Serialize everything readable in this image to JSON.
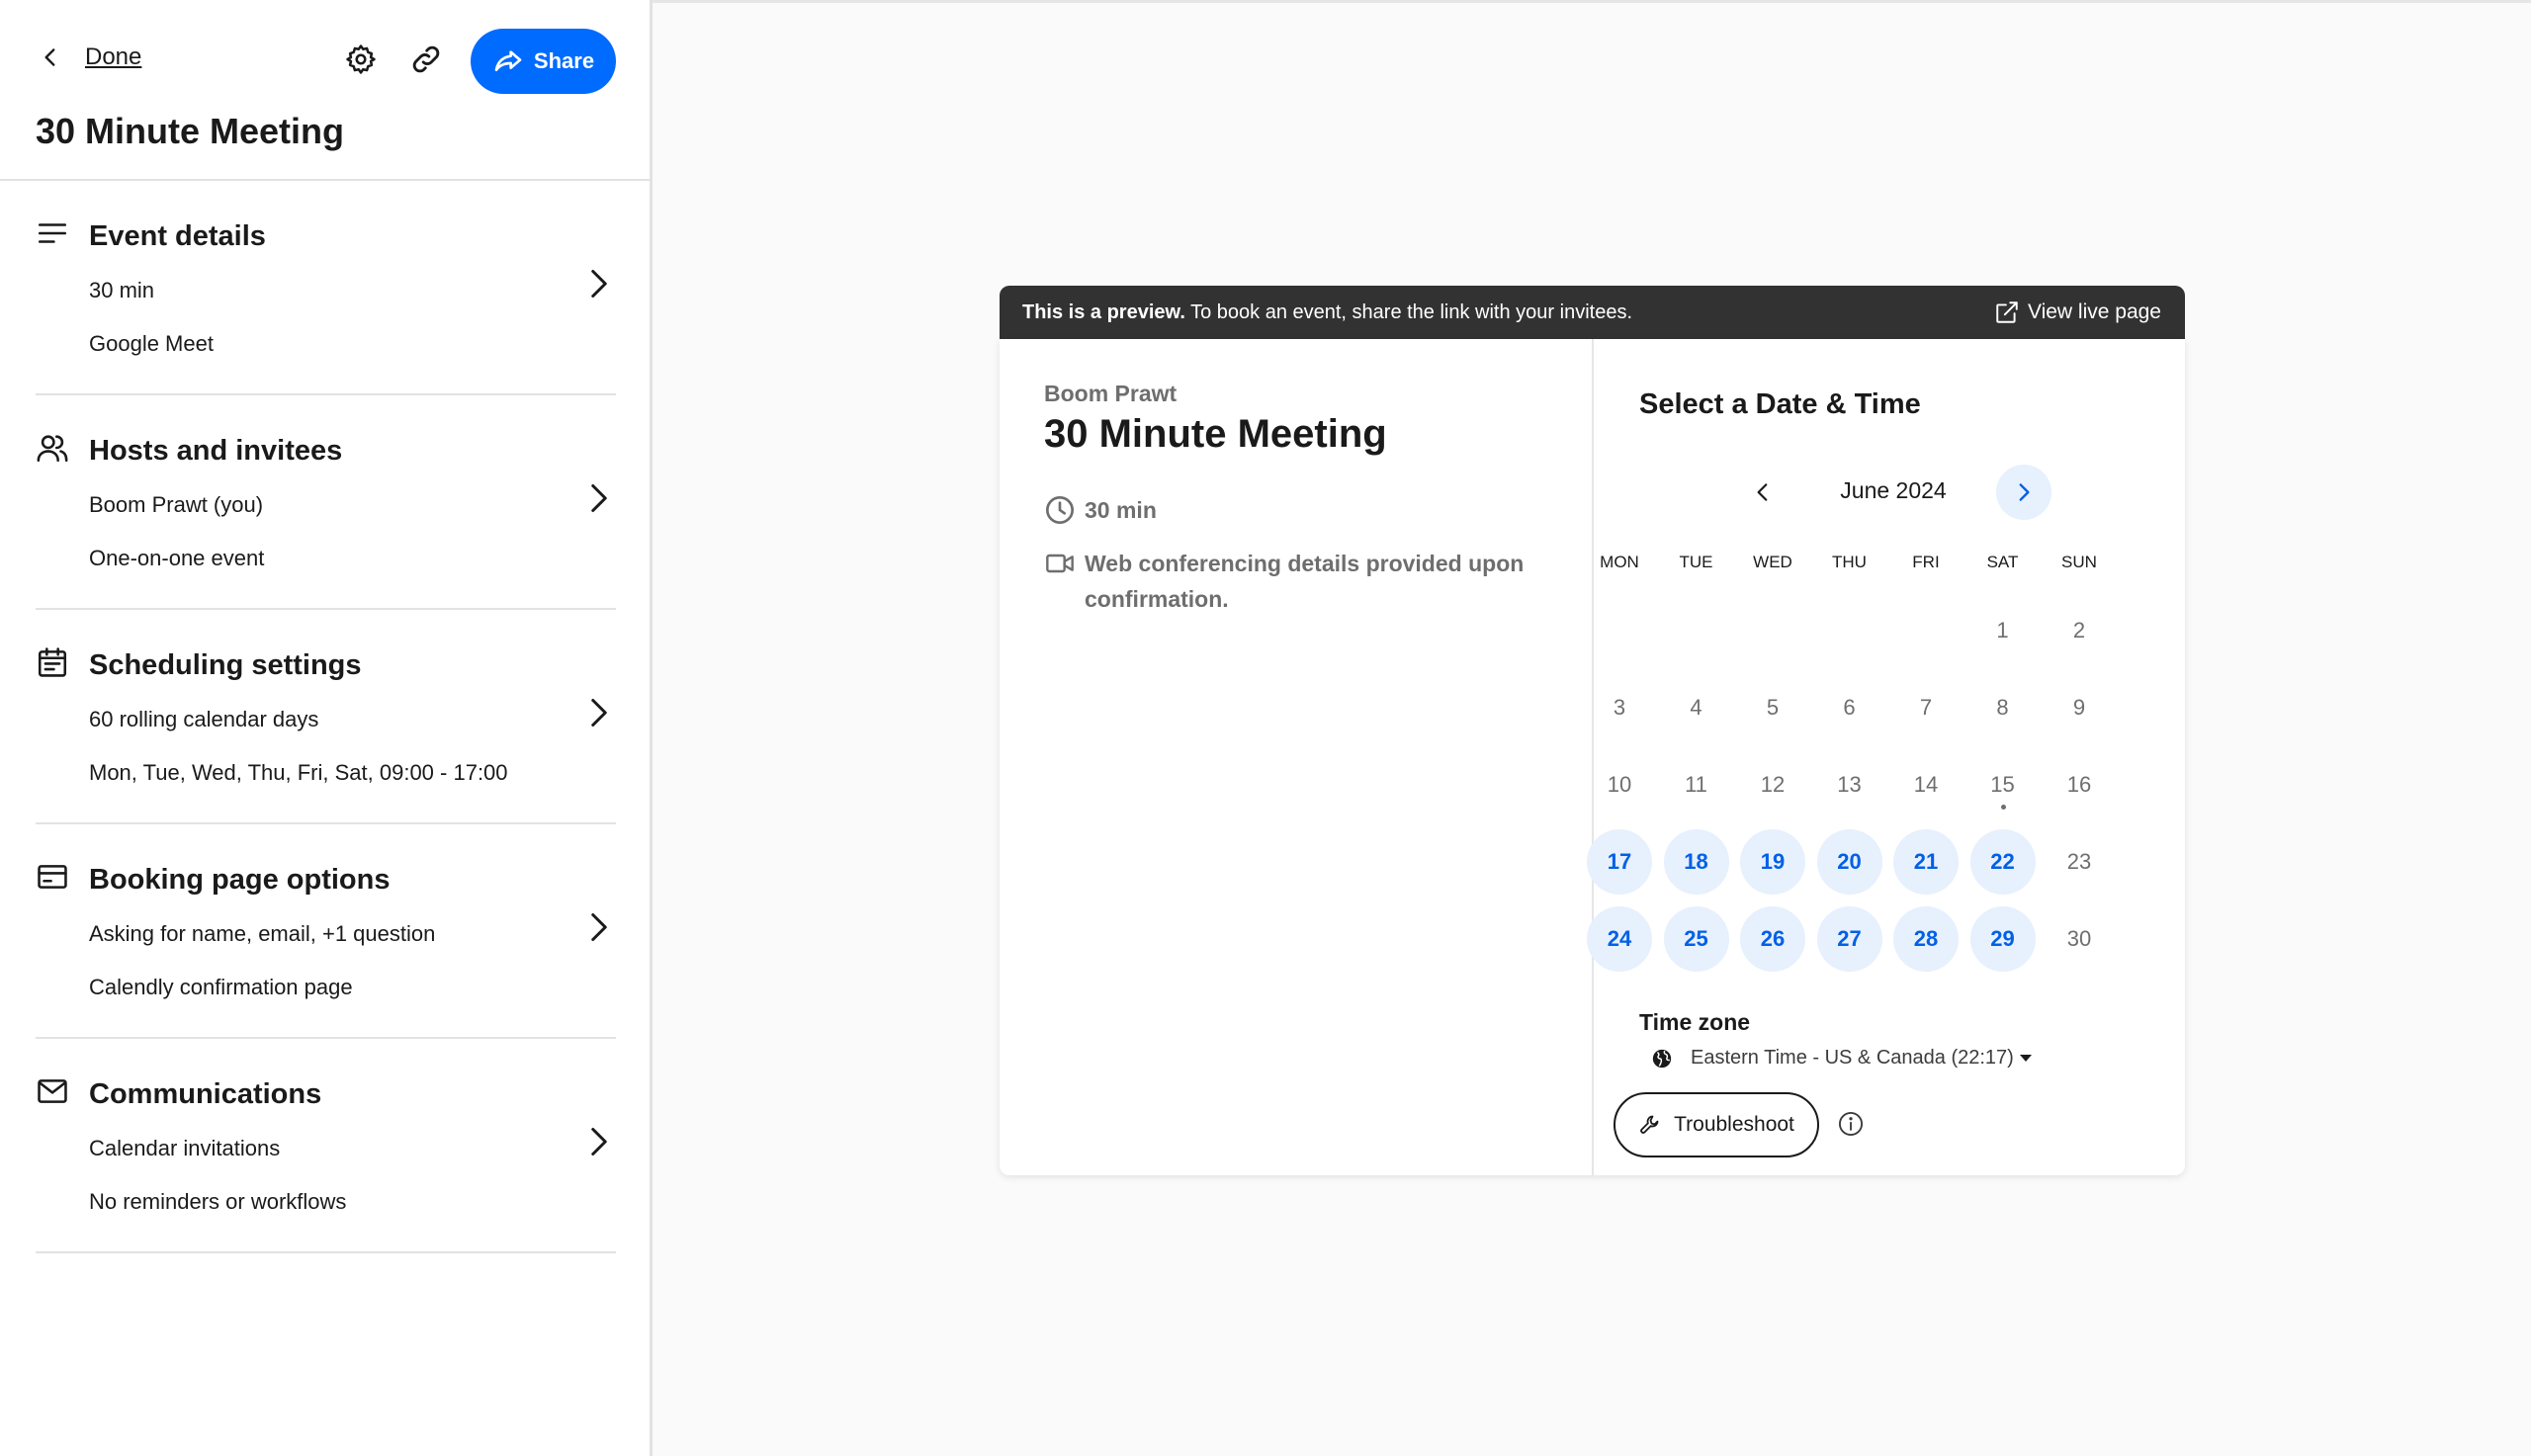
{
  "sidebar": {
    "back_label": "Done",
    "share_label": "Share",
    "title": "30 Minute Meeting",
    "sections": [
      {
        "title": "Event details",
        "line1": "30 min",
        "line2": "Google Meet",
        "icon": "lines-icon"
      },
      {
        "title": "Hosts and invitees",
        "line1": "Boom Prawt (you)",
        "line2": "One-on-one event",
        "icon": "people-icon"
      },
      {
        "title": "Scheduling settings",
        "line1": "60 rolling calendar days",
        "line2": "Mon, Tue, Wed, Thu, Fri, Sat, 09:00 - 17:00",
        "icon": "calendar-icon"
      },
      {
        "title": "Booking page options",
        "line1": "Asking for name, email, +1 question",
        "line2": "Calendly confirmation page",
        "icon": "card-icon"
      },
      {
        "title": "Communications",
        "line1": "Calendar invitations",
        "line2": "No reminders or workflows",
        "icon": "envelope-icon"
      }
    ]
  },
  "preview": {
    "banner_bold": "This is a preview.",
    "banner_text": " To book an event, share the link with your invitees.",
    "view_live_label": "View live page",
    "organizer": "Boom Prawt",
    "event_name": "30 Minute Meeting",
    "duration": "30 min",
    "location": "Web conferencing details provided upon confirmation.",
    "select_title": "Select a Date & Time",
    "month_label": "June 2024",
    "weekdays": [
      "MON",
      "TUE",
      "WED",
      "THU",
      "FRI",
      "SAT",
      "SUN"
    ],
    "days": [
      {
        "d": "1",
        "col": 5,
        "row": 0,
        "avail": false
      },
      {
        "d": "2",
        "col": 6,
        "row": 0,
        "avail": false
      },
      {
        "d": "3",
        "col": 0,
        "row": 1,
        "avail": false
      },
      {
        "d": "4",
        "col": 1,
        "row": 1,
        "avail": false
      },
      {
        "d": "5",
        "col": 2,
        "row": 1,
        "avail": false
      },
      {
        "d": "6",
        "col": 3,
        "row": 1,
        "avail": false
      },
      {
        "d": "7",
        "col": 4,
        "row": 1,
        "avail": false
      },
      {
        "d": "8",
        "col": 5,
        "row": 1,
        "avail": false
      },
      {
        "d": "9",
        "col": 6,
        "row": 1,
        "avail": false
      },
      {
        "d": "10",
        "col": 0,
        "row": 2,
        "avail": false
      },
      {
        "d": "11",
        "col": 1,
        "row": 2,
        "avail": false
      },
      {
        "d": "12",
        "col": 2,
        "row": 2,
        "avail": false
      },
      {
        "d": "13",
        "col": 3,
        "row": 2,
        "avail": false
      },
      {
        "d": "14",
        "col": 4,
        "row": 2,
        "avail": false
      },
      {
        "d": "15",
        "col": 5,
        "row": 2,
        "avail": false,
        "today": true
      },
      {
        "d": "16",
        "col": 6,
        "row": 2,
        "avail": false
      },
      {
        "d": "17",
        "col": 0,
        "row": 3,
        "avail": true
      },
      {
        "d": "18",
        "col": 1,
        "row": 3,
        "avail": true
      },
      {
        "d": "19",
        "col": 2,
        "row": 3,
        "avail": true
      },
      {
        "d": "20",
        "col": 3,
        "row": 3,
        "avail": true
      },
      {
        "d": "21",
        "col": 4,
        "row": 3,
        "avail": true
      },
      {
        "d": "22",
        "col": 5,
        "row": 3,
        "avail": true
      },
      {
        "d": "23",
        "col": 6,
        "row": 3,
        "avail": false
      },
      {
        "d": "24",
        "col": 0,
        "row": 4,
        "avail": true
      },
      {
        "d": "25",
        "col": 1,
        "row": 4,
        "avail": true
      },
      {
        "d": "26",
        "col": 2,
        "row": 4,
        "avail": true
      },
      {
        "d": "27",
        "col": 3,
        "row": 4,
        "avail": true
      },
      {
        "d": "28",
        "col": 4,
        "row": 4,
        "avail": true
      },
      {
        "d": "29",
        "col": 5,
        "row": 4,
        "avail": true
      },
      {
        "d": "30",
        "col": 6,
        "row": 4,
        "avail": false
      }
    ],
    "timezone_label": "Time zone",
    "timezone_value": "Eastern Time - US & Canada (22:17)",
    "troubleshoot_label": "Troubleshoot"
  },
  "colors": {
    "accent": "#006bff",
    "available_bg": "#e7f0fd",
    "available_text": "#0060e6",
    "banner_bg": "#323232"
  }
}
